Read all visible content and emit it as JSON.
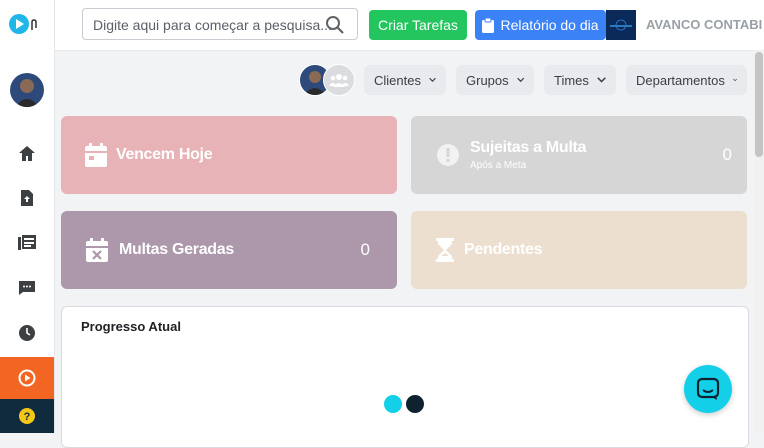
{
  "sidebar": {
    "items": [
      {
        "name": "home-icon"
      },
      {
        "name": "upload-file-icon"
      },
      {
        "name": "list-icon"
      },
      {
        "name": "chat-icon"
      },
      {
        "name": "clock-icon"
      },
      {
        "name": "play-icon",
        "active": true
      },
      {
        "name": "help-icon"
      }
    ]
  },
  "header": {
    "search_placeholder": "Digite aqui para começar a pesquisa...",
    "create_tasks_label": "Criar Tarefas",
    "daily_report_label": "Relatório do dia",
    "company_name": "AVANCO CONTABI"
  },
  "filters": {
    "clients": "Clientes",
    "groups": "Grupos",
    "teams": "Times",
    "departments": "Departamentos"
  },
  "cards": {
    "due_today": {
      "label": "Vencem Hoje",
      "value": ""
    },
    "subject_to_fine": {
      "label": "Sujeitas a Multa",
      "sublabel": "Após a Meta",
      "value": "0"
    },
    "fines_generated": {
      "label": "Multas Geradas",
      "value": "0"
    },
    "pending": {
      "label": "Pendentes",
      "value": ""
    }
  },
  "progress": {
    "title": "Progresso Atual"
  },
  "colors": {
    "accent_orange": "#f26522",
    "green_button": "#22c55e",
    "blue_button": "#3b82f6",
    "card_red": "#e7b3b6",
    "card_gray": "#d6d6d6",
    "card_purple": "#ac97ab",
    "card_beige": "#ecdfcf",
    "chat_cyan": "#13d0e8"
  }
}
